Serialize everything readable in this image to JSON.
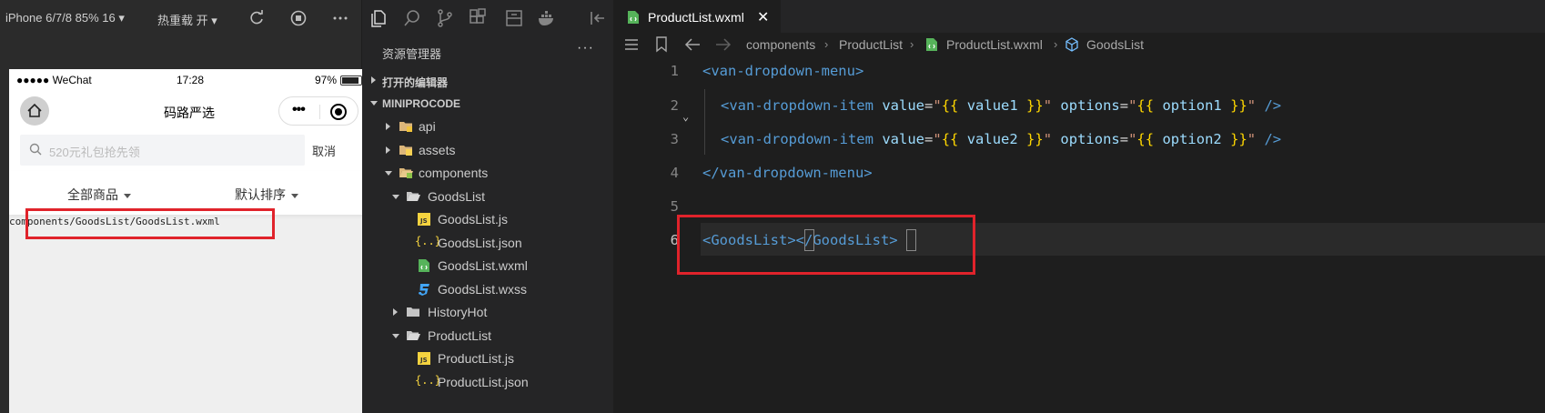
{
  "simulator": {
    "device": "iPhone 6/7/8 85% 16 ▾",
    "hot_reload": "热重载 开 ▾",
    "statusbar": {
      "carrier": "●●●●● WeChat",
      "time": "17:28",
      "battery": "97%"
    },
    "nav_title": "码路严选",
    "search_placeholder": "520元礼包抢先领",
    "search_cancel": "取消",
    "filter_all": "全部商品",
    "filter_sort": "默认排序",
    "component_path": "components/GoodsList/GoodsList.wxml"
  },
  "explorer": {
    "title": "资源管理器",
    "more": "···",
    "open_editors": "打开的编辑器",
    "project": "MINIPROCODE",
    "items": [
      {
        "label": "api"
      },
      {
        "label": "assets"
      },
      {
        "label": "components"
      },
      {
        "label": "GoodsList"
      },
      {
        "label": "GoodsList.js"
      },
      {
        "label": "GoodsList.json"
      },
      {
        "label": "GoodsList.wxml"
      },
      {
        "label": "GoodsList.wxss"
      },
      {
        "label": "HistoryHot"
      },
      {
        "label": "ProductList"
      },
      {
        "label": "ProductList.js"
      },
      {
        "label": "ProductList.json"
      }
    ]
  },
  "editor": {
    "tab_name": "ProductList.wxml",
    "tab_close": "✕",
    "breadcrumb": [
      "components",
      "ProductList",
      "ProductList.wxml",
      "GoodsList"
    ],
    "lines": [
      {
        "n": "1"
      },
      {
        "n": "2"
      },
      {
        "n": "3"
      },
      {
        "n": "4"
      },
      {
        "n": "5"
      },
      {
        "n": "6"
      }
    ],
    "code": {
      "l1_tag": "<van-dropdown-menu>",
      "l2_open": "<van-dropdown-item",
      "attr_value": "value",
      "attr_options": "options",
      "l2_value": "value1",
      "l2_option": "option1",
      "l3_value": "value2",
      "l3_option": "option2",
      "close_selfclosing": "/>",
      "l4_tag": "</van-dropdown-menu>",
      "l6_open": "<GoodsList>",
      "l6_close": "</GoodsList>"
    }
  },
  "colors": {
    "highlight_box": "#e0232b",
    "tag": "#569cd6",
    "attr": "#9cdcfe",
    "string": "#ce9178",
    "brace": "#ffd700"
  }
}
